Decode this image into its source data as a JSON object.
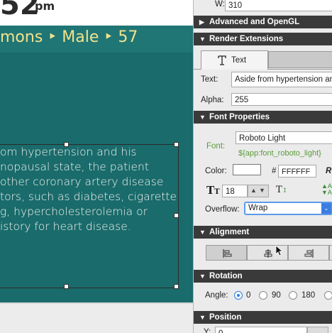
{
  "canvas": {
    "time": "52",
    "time_suffix": "pm",
    "breadcrumb": "mons ‣ Male ‣ 57",
    "body_lines": [
      "om hypertension and his",
      "nopausal state, the patient",
      "other coronary artery disease",
      "tors, such as diabetes, cigarette",
      "g, hypercholesterolemia or",
      "istory for heart disease."
    ]
  },
  "panel": {
    "w_label": "W:",
    "w_value": "310",
    "sections": {
      "advanced": "Advanced and OpenGL",
      "render_ext": "Render Extensions",
      "font_props": "Font Properties",
      "alignment": "Alignment",
      "rotation": "Rotation",
      "position": "Position"
    },
    "tab_text": "Text",
    "text_label": "Text:",
    "text_value": "Aside from hypertension and",
    "alpha_label": "Alpha:",
    "alpha_value": "255",
    "font_label": "Font:",
    "font_value": "Roboto Light",
    "font_binding": "${app:font_roboto_light}",
    "color_label": "Color:",
    "hash": "#",
    "color_hex": "FFFFFF",
    "r_label": "R",
    "size_value": "18",
    "overflow_label": "Overflow:",
    "overflow_value": "Wrap",
    "angle_label": "Angle:",
    "angles": [
      "0",
      "90",
      "180"
    ],
    "selected_angle": "0",
    "y_label": "Y:",
    "y_value": "0",
    "accent": "#2a7de1"
  }
}
